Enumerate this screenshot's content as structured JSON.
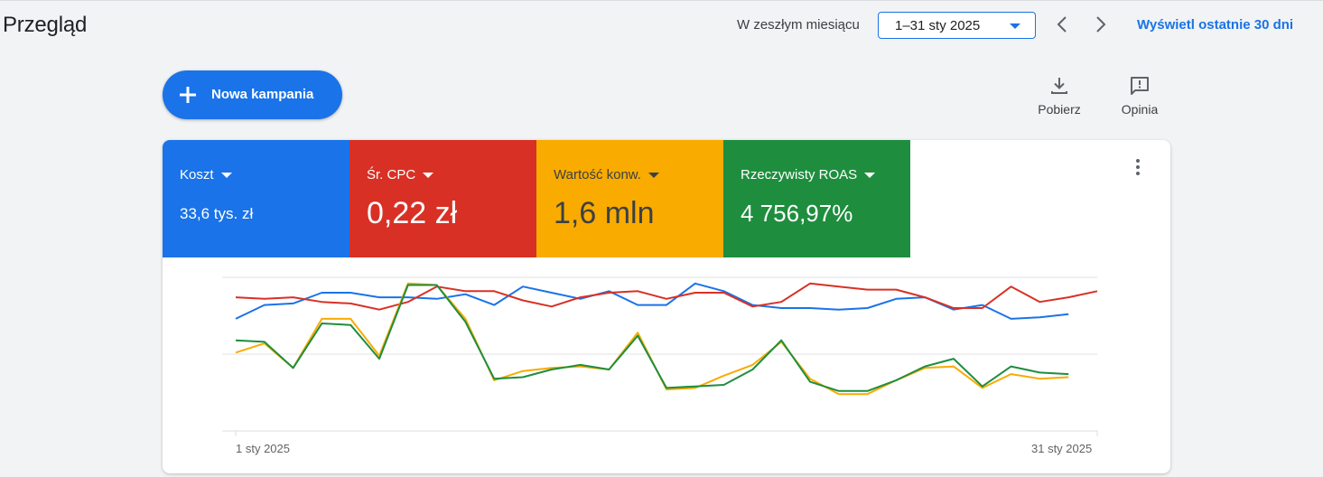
{
  "header": {
    "title": "Przegląd",
    "range_label": "W zeszłym miesiącu",
    "date_range": "1–31 sty 2025",
    "last30_label": "Wyświetl ostatnie 30 dni"
  },
  "actions": {
    "new_campaign_label": "Nowa kampania",
    "download_label": "Pobierz",
    "feedback_label": "Opinia"
  },
  "metrics": [
    {
      "name": "Koszt",
      "value": "33,6 tys. zł",
      "color": "#1a73e8"
    },
    {
      "name": "Śr. CPC",
      "value": "0,22 zł",
      "color": "#d93025"
    },
    {
      "name": "Wartość konw.",
      "value": "1,6 mln",
      "color": "#f9ab00"
    },
    {
      "name": "Rzeczywisty ROAS",
      "value": "4 756,97%",
      "color": "#1e8e3e"
    }
  ],
  "icons": {
    "new_campaign": "plus-icon",
    "download": "download-icon",
    "feedback": "feedback-icon",
    "prev": "chevron-left-icon",
    "next": "chevron-right-icon",
    "more": "more-vert-icon"
  },
  "chart_data": {
    "type": "line",
    "x_labels": [
      "1 sty 2025",
      "31 sty 2025"
    ],
    "x": [
      1,
      2,
      3,
      4,
      5,
      6,
      7,
      8,
      9,
      10,
      11,
      12,
      13,
      14,
      15,
      16,
      17,
      18,
      19,
      20,
      21,
      22,
      23,
      24,
      25,
      26,
      27,
      28,
      29,
      30,
      31
    ],
    "ylim": [
      0,
      100
    ],
    "grid": true,
    "series": [
      {
        "key": "cost",
        "color": "#1a73e8",
        "values": [
          73,
          82,
          83,
          90,
          90,
          87,
          87,
          86,
          89,
          82,
          94,
          90,
          86,
          91,
          82,
          82,
          96,
          91,
          82,
          80,
          80,
          79,
          80,
          86,
          87,
          79,
          82,
          73,
          74,
          76
        ]
      },
      {
        "key": "cpc",
        "color": "#d93025",
        "values": [
          87,
          86,
          87,
          84,
          83,
          79,
          84,
          94,
          91,
          91,
          85,
          81,
          87,
          90,
          91,
          86,
          90,
          90,
          81,
          84,
          96,
          94,
          92,
          92,
          87,
          80,
          80,
          94,
          84,
          87,
          91
        ]
      },
      {
        "key": "conv_value",
        "color": "#f9ab00",
        "values": [
          51,
          57,
          41,
          73,
          73,
          49,
          96,
          95,
          73,
          33,
          39,
          41,
          42,
          40,
          64,
          27,
          28,
          36,
          43,
          58,
          34,
          24,
          24,
          33,
          41,
          42,
          28,
          37,
          34,
          35
        ]
      },
      {
        "key": "roas",
        "color": "#1e8e3e",
        "values": [
          59,
          58,
          41,
          70,
          69,
          47,
          95,
          95,
          71,
          34,
          35,
          40,
          43,
          40,
          62,
          28,
          29,
          30,
          40,
          59,
          32,
          26,
          26,
          33,
          42,
          47,
          29,
          42,
          38,
          37
        ]
      }
    ]
  }
}
